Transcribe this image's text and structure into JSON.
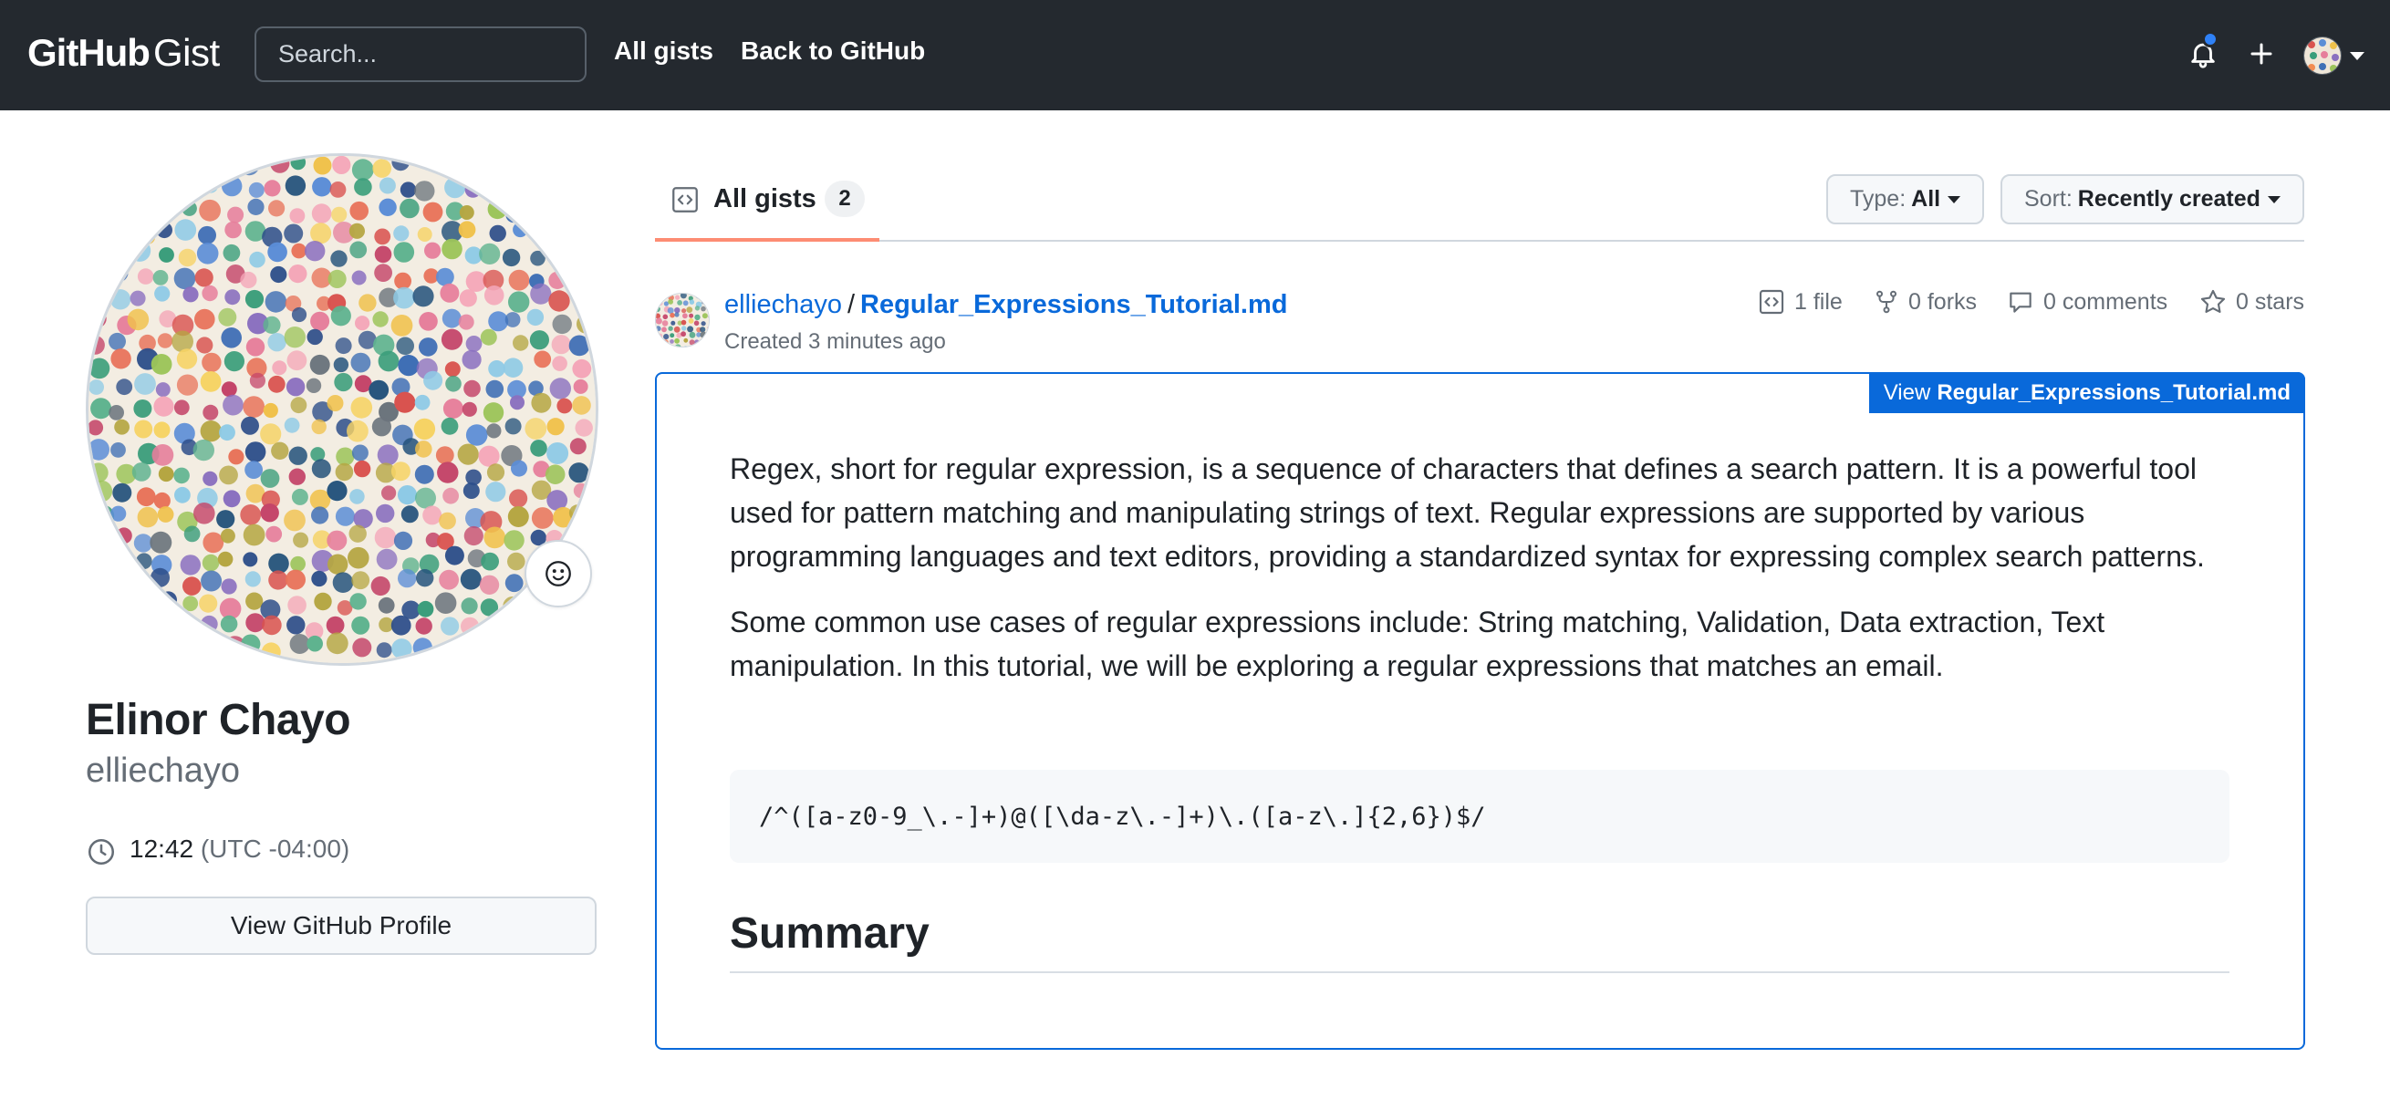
{
  "header": {
    "logo_github": "GitHub",
    "logo_gist": "Gist",
    "search_placeholder": "Search...",
    "nav": [
      "All gists",
      "Back to GitHub"
    ],
    "icons": [
      "bell-icon",
      "plus-icon",
      "avatar",
      "caret-down-icon"
    ],
    "notification_dot_color": "#2f81f7"
  },
  "profile": {
    "name": "Elinor Chayo",
    "username": "elliechayo",
    "local_time": "12:42",
    "timezone": "(UTC -04:00)",
    "view_profile_button": "View GitHub Profile"
  },
  "tabs": {
    "active_label": "All gists",
    "count": "2",
    "underline_color": "#fd8c73"
  },
  "filters": {
    "type_label": "Type:",
    "type_value": "All",
    "sort_label": "Sort:",
    "sort_value": "Recently created"
  },
  "gist": {
    "owner": "elliechayo",
    "separator": "/",
    "filename": "Regular_Expressions_Tutorial.md",
    "created": "Created 3 minutes ago",
    "files": "1 file",
    "forks": "0 forks",
    "comments": "0 comments",
    "stars": "0 stars",
    "view_button_prefix": "View",
    "view_button_file": "Regular_Expressions_Tutorial.md",
    "paragraph_1": "Regex, short for regular expression, is a sequence of characters that defines a search pattern. It is a powerful tool used for pattern matching and manipulating strings of text. Regular expressions are supported by various programming languages and text editors, providing a standardized syntax for expressing complex search patterns.",
    "paragraph_2": "Some common use cases of regular expressions include: String matching, Validation, Data extraction, Text manipulation. In this tutorial, we will be exploring a regular expressions that matches an email.",
    "code": "/^([a-z0-9_\\.-]+)@([\\da-z\\.-]+)\\.([a-z\\.]{2,6})$/",
    "heading": "Summary"
  },
  "colors": {
    "header_bg": "#24292f",
    "link": "#0969da",
    "border": "#d0d7de"
  }
}
